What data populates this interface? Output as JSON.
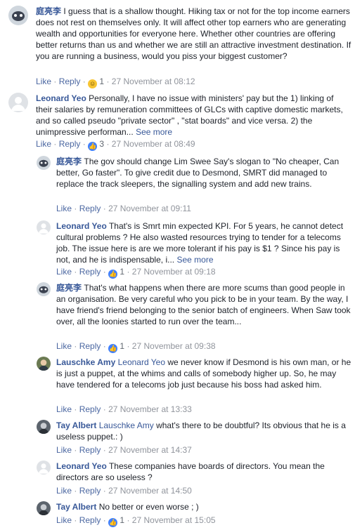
{
  "comments": [
    {
      "author": "庭亮李",
      "tag": "",
      "body": "I guess that is a shallow thought. Hiking tax or not for the top income earners does not rest on themselves only. It will affect other top earners who are generating wealth and opportunities for everyone here. Whether other countries are offering better returns than us and whether we are still an attractive investment destination. If you are running a business, would you piss your biggest customer?",
      "see_more": "",
      "like": "Like",
      "reply": "Reply",
      "reaction": "haha-icon",
      "reaction_count": "1",
      "time": "27 November at 08:12"
    },
    {
      "author": "Leonard Yeo",
      "tag": "",
      "body": "Personally, I have no issue with ministers' pay but the 1) linking of their salaries by remuneration committees of GLCs with captive domestic markets, and so called pseudo \"private sector\" , \"stat boards\" and vice versa. 2) the unimpressive performan...",
      "see_more": "See more",
      "like": "Like",
      "reply": "Reply",
      "reaction": "like-icon",
      "reaction_count": "3",
      "time": "27 November at 08:49"
    },
    {
      "author": "庭亮李",
      "tag": "",
      "body": "The gov should change Lim Swee Say's slogan to \"No cheaper, Can better, Go faster\". To give credit due to Desmond, SMRT did managed to replace the track sleepers, the signalling system and add new trains.",
      "see_more": "",
      "like": "Like",
      "reply": "Reply",
      "reaction": "",
      "reaction_count": "",
      "time": "27 November at 09:11"
    },
    {
      "author": "Leonard Yeo",
      "tag": "",
      "body": "That's is Smrt min expected KPI. For 5 years, he cannot detect cultural problems ? He also wasted resources trying to tender for a telecoms job. The issue here is are we more tolerant if his pay is $1 ? Since his pay is not, and he is indispensable, i...",
      "see_more": "See more",
      "like": "Like",
      "reply": "Reply",
      "reaction": "like-icon",
      "reaction_count": "1",
      "time": "27 November at 09:18"
    },
    {
      "author": "庭亮李",
      "tag": "",
      "body": "That's what happens when there are more scums than good people in an organisation. Be very careful who you pick to be in your team. By the way, I have friend's friend belonging to the senior batch of engineers. When Saw took over, all the loonies started to run over the team...",
      "see_more": "",
      "like": "Like",
      "reply": "Reply",
      "reaction": "like-icon",
      "reaction_count": "1",
      "time": "27 November at 09:38"
    },
    {
      "author": "Lauschke Amy",
      "tag": "Leonard Yeo",
      "body": "we never know if Desmond is his own man, or he is just a puppet, at the whims and calls of somebody higher up. So, he may have tendered for a telecoms job just because his boss had asked him.",
      "see_more": "",
      "like": "Like",
      "reply": "Reply",
      "reaction": "",
      "reaction_count": "",
      "time": "27 November at 13:33"
    },
    {
      "author": "Tay Albert",
      "tag": "Lauschke Amy",
      "body": "what's there to be doubtful? Its obvious that he is a useless puppet.: )",
      "see_more": "",
      "like": "Like",
      "reply": "Reply",
      "reaction": "",
      "reaction_count": "",
      "time": "27 November at 14:37"
    },
    {
      "author": "Leonard Yeo",
      "tag": "",
      "body": "These companies have boards of directors. You mean the directors are so useless ?",
      "see_more": "",
      "like": "Like",
      "reply": "Reply",
      "reaction": "",
      "reaction_count": "",
      "time": "27 November at 14:50"
    },
    {
      "author": "Tay Albert",
      "tag": "",
      "body": "No better or even worse ; )",
      "see_more": "",
      "like": "Like",
      "reply": "Reply",
      "reaction": "like-icon",
      "reaction_count": "1",
      "time": "27 November at 15:05"
    }
  ],
  "separator": "·",
  "colors": {
    "link": "#385898",
    "meta": "#90949c",
    "like_badge": "#4080ff",
    "haha_badge": "#f7c431"
  }
}
